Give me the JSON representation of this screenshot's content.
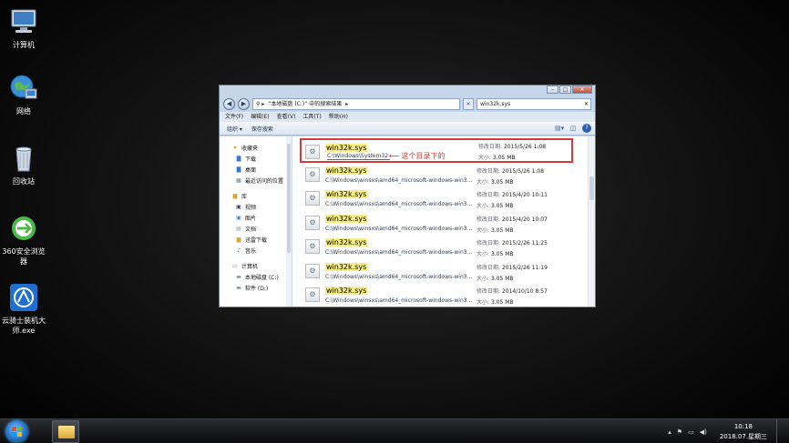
{
  "desktop": {
    "icons": [
      {
        "label": "计算机",
        "icon": "computer-icon"
      },
      {
        "label": "网络",
        "icon": "network-icon"
      },
      {
        "label": "回收站",
        "icon": "recycle-bin-icon"
      },
      {
        "label": "360安全浏览器",
        "icon": "browser-360-icon"
      },
      {
        "label": "云骑士装机大师.exe",
        "icon": "yunqishi-icon"
      }
    ]
  },
  "explorer": {
    "address": [
      "“本地磁盘 (C:)” 中的搜索结果",
      "▸"
    ],
    "search_value": "win32k.sys",
    "menu": [
      "文件(F)",
      "编辑(E)",
      "查看(V)",
      "工具(T)",
      "帮助(H)"
    ],
    "toolbar": {
      "organize": "组织 ▾",
      "save_search": "保存搜索"
    },
    "nav": {
      "favorites": "收藏夹",
      "favorites_items": [
        "下载",
        "桌面",
        "最近访问的位置"
      ],
      "library": "库",
      "library_items": [
        "视频",
        "图片",
        "文档",
        "迅雷下载",
        "音乐"
      ],
      "computer": "计算机",
      "computer_items": [
        "本地磁盘 (C:)",
        "软件 (D:)"
      ]
    },
    "labels": {
      "modified": "修改日期:",
      "size": "大小:"
    },
    "results": [
      {
        "name": "win32k.sys",
        "path": "C:\\Windows\\System32",
        "date": "2015/5/26 1:08",
        "size": "3.05 MB"
      },
      {
        "name": "win32k.sys",
        "path": "C:\\Windows\\winsxs\\amd64_microsoft-windows-win3...",
        "date": "2015/5/26 1:08",
        "size": "3.05 MB"
      },
      {
        "name": "win32k.sys",
        "path": "C:\\Windows\\winsxs\\amd64_microsoft-windows-win3...",
        "date": "2015/4/20 10:11",
        "size": "3.05 MB"
      },
      {
        "name": "win32k.sys",
        "path": "C:\\Windows\\winsxs\\amd64_microsoft-windows-win3...",
        "date": "2015/4/20 10:07",
        "size": "3.05 MB"
      },
      {
        "name": "win32k.sys",
        "path": "C:\\Windows\\winsxs\\amd64_microsoft-windows-win3...",
        "date": "2015/2/26 11:25",
        "size": "3.05 MB"
      },
      {
        "name": "win32k.sys",
        "path": "C:\\Windows\\winsxs\\amd64_microsoft-windows-win3...",
        "date": "2015/2/26 11:19",
        "size": "3.05 MB"
      },
      {
        "name": "win32k.sys",
        "path": "C:\\Windows\\winsxs\\amd64_microsoft-windows-win3...",
        "date": "2014/10/10 8:57",
        "size": "3.05 MB"
      }
    ],
    "annotation": "这个目录下的",
    "annotation_color": "#d23b3b"
  },
  "taskbar": {
    "time": "10:18",
    "date": "2018.07.星期三"
  }
}
